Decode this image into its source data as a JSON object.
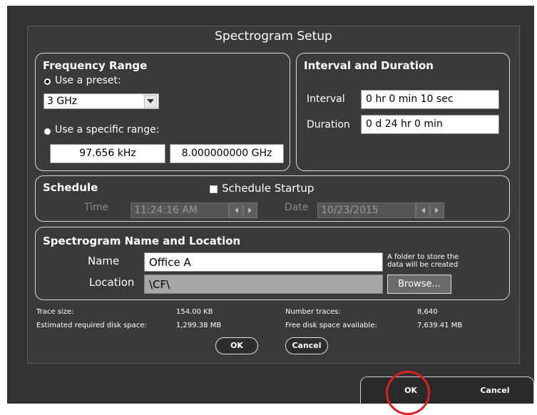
{
  "dialog": {
    "title": "Spectrogram Setup"
  },
  "frequency_range": {
    "title": "Frequency Range",
    "preset_label": "Use a preset:",
    "preset_value": "3 GHz",
    "specific_label": "Use a specific range:",
    "start_value": "97.656 kHz",
    "stop_value": "8.000000000 GHz"
  },
  "interval_duration": {
    "title": "Interval and Duration",
    "interval_label": "Interval",
    "interval_value": "0 hr 0 min 10 sec",
    "duration_label": "Duration",
    "duration_value": "0 d 24 hr 0 min"
  },
  "schedule": {
    "title": "Schedule",
    "startup_label": "Schedule Startup",
    "time_label": "Time",
    "time_value": "11:24:16 AM",
    "date_label": "Date",
    "date_value": "10/23/2015"
  },
  "name_location": {
    "title": "Spectrogram Name and Location",
    "name_label": "Name",
    "name_value": "Office A",
    "folder_note": "A folder to store the data will be created",
    "location_label": "Location",
    "location_value": "\\CF\\",
    "browse_label": "Browse..."
  },
  "stats": {
    "trace_size_label": "Trace size:",
    "trace_size_value": "154.00 KB",
    "disk_required_label": "Estimated required disk space:",
    "disk_required_value": "1,299.38 MB",
    "num_traces_label": "Number traces:",
    "num_traces_value": "8,640",
    "free_space_label": "Free disk space available:",
    "free_space_value": "7,639.41 MB"
  },
  "buttons": {
    "ok": "OK",
    "cancel": "Cancel"
  },
  "bottom_bar": {
    "ok": "OK",
    "cancel": "Cancel"
  },
  "icons": {
    "dropdown": "chevron-down-icon",
    "spin_left": "arrow-left-icon",
    "spin_right": "arrow-right-icon"
  },
  "colors": {
    "highlight": "#e02020"
  }
}
